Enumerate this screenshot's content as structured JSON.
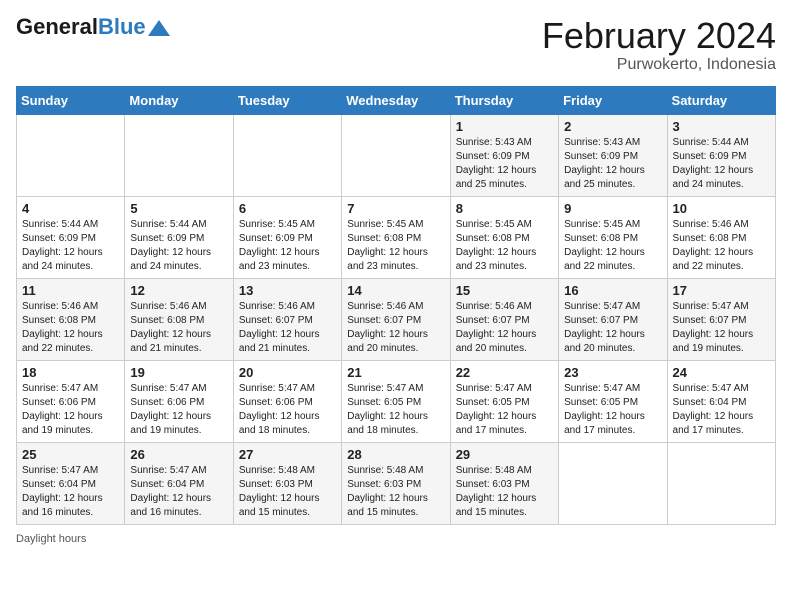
{
  "header": {
    "logo_general": "General",
    "logo_blue": "Blue",
    "month_year": "February 2024",
    "location": "Purwokerto, Indonesia"
  },
  "days": [
    "Sunday",
    "Monday",
    "Tuesday",
    "Wednesday",
    "Thursday",
    "Friday",
    "Saturday"
  ],
  "footer": {
    "label": "Daylight hours"
  },
  "weeks": [
    {
      "cells": [
        {
          "day": "",
          "content": ""
        },
        {
          "day": "",
          "content": ""
        },
        {
          "day": "",
          "content": ""
        },
        {
          "day": "",
          "content": ""
        },
        {
          "day": "1",
          "content": "Sunrise: 5:43 AM\nSunset: 6:09 PM\nDaylight: 12 hours\nand 25 minutes."
        },
        {
          "day": "2",
          "content": "Sunrise: 5:43 AM\nSunset: 6:09 PM\nDaylight: 12 hours\nand 25 minutes."
        },
        {
          "day": "3",
          "content": "Sunrise: 5:44 AM\nSunset: 6:09 PM\nDaylight: 12 hours\nand 24 minutes."
        }
      ]
    },
    {
      "cells": [
        {
          "day": "4",
          "content": "Sunrise: 5:44 AM\nSunset: 6:09 PM\nDaylight: 12 hours\nand 24 minutes."
        },
        {
          "day": "5",
          "content": "Sunrise: 5:44 AM\nSunset: 6:09 PM\nDaylight: 12 hours\nand 24 minutes."
        },
        {
          "day": "6",
          "content": "Sunrise: 5:45 AM\nSunset: 6:09 PM\nDaylight: 12 hours\nand 23 minutes."
        },
        {
          "day": "7",
          "content": "Sunrise: 5:45 AM\nSunset: 6:08 PM\nDaylight: 12 hours\nand 23 minutes."
        },
        {
          "day": "8",
          "content": "Sunrise: 5:45 AM\nSunset: 6:08 PM\nDaylight: 12 hours\nand 23 minutes."
        },
        {
          "day": "9",
          "content": "Sunrise: 5:45 AM\nSunset: 6:08 PM\nDaylight: 12 hours\nand 22 minutes."
        },
        {
          "day": "10",
          "content": "Sunrise: 5:46 AM\nSunset: 6:08 PM\nDaylight: 12 hours\nand 22 minutes."
        }
      ]
    },
    {
      "cells": [
        {
          "day": "11",
          "content": "Sunrise: 5:46 AM\nSunset: 6:08 PM\nDaylight: 12 hours\nand 22 minutes."
        },
        {
          "day": "12",
          "content": "Sunrise: 5:46 AM\nSunset: 6:08 PM\nDaylight: 12 hours\nand 21 minutes."
        },
        {
          "day": "13",
          "content": "Sunrise: 5:46 AM\nSunset: 6:07 PM\nDaylight: 12 hours\nand 21 minutes."
        },
        {
          "day": "14",
          "content": "Sunrise: 5:46 AM\nSunset: 6:07 PM\nDaylight: 12 hours\nand 20 minutes."
        },
        {
          "day": "15",
          "content": "Sunrise: 5:46 AM\nSunset: 6:07 PM\nDaylight: 12 hours\nand 20 minutes."
        },
        {
          "day": "16",
          "content": "Sunrise: 5:47 AM\nSunset: 6:07 PM\nDaylight: 12 hours\nand 20 minutes."
        },
        {
          "day": "17",
          "content": "Sunrise: 5:47 AM\nSunset: 6:07 PM\nDaylight: 12 hours\nand 19 minutes."
        }
      ]
    },
    {
      "cells": [
        {
          "day": "18",
          "content": "Sunrise: 5:47 AM\nSunset: 6:06 PM\nDaylight: 12 hours\nand 19 minutes."
        },
        {
          "day": "19",
          "content": "Sunrise: 5:47 AM\nSunset: 6:06 PM\nDaylight: 12 hours\nand 19 minutes."
        },
        {
          "day": "20",
          "content": "Sunrise: 5:47 AM\nSunset: 6:06 PM\nDaylight: 12 hours\nand 18 minutes."
        },
        {
          "day": "21",
          "content": "Sunrise: 5:47 AM\nSunset: 6:05 PM\nDaylight: 12 hours\nand 18 minutes."
        },
        {
          "day": "22",
          "content": "Sunrise: 5:47 AM\nSunset: 6:05 PM\nDaylight: 12 hours\nand 17 minutes."
        },
        {
          "day": "23",
          "content": "Sunrise: 5:47 AM\nSunset: 6:05 PM\nDaylight: 12 hours\nand 17 minutes."
        },
        {
          "day": "24",
          "content": "Sunrise: 5:47 AM\nSunset: 6:04 PM\nDaylight: 12 hours\nand 17 minutes."
        }
      ]
    },
    {
      "cells": [
        {
          "day": "25",
          "content": "Sunrise: 5:47 AM\nSunset: 6:04 PM\nDaylight: 12 hours\nand 16 minutes."
        },
        {
          "day": "26",
          "content": "Sunrise: 5:47 AM\nSunset: 6:04 PM\nDaylight: 12 hours\nand 16 minutes."
        },
        {
          "day": "27",
          "content": "Sunrise: 5:48 AM\nSunset: 6:03 PM\nDaylight: 12 hours\nand 15 minutes."
        },
        {
          "day": "28",
          "content": "Sunrise: 5:48 AM\nSunset: 6:03 PM\nDaylight: 12 hours\nand 15 minutes."
        },
        {
          "day": "29",
          "content": "Sunrise: 5:48 AM\nSunset: 6:03 PM\nDaylight: 12 hours\nand 15 minutes."
        },
        {
          "day": "",
          "content": ""
        },
        {
          "day": "",
          "content": ""
        }
      ]
    }
  ]
}
